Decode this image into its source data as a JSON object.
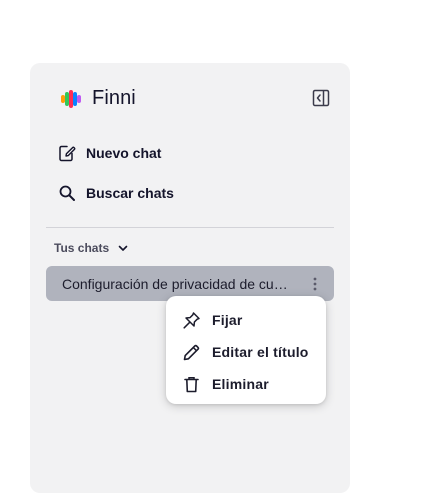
{
  "sidebar": {
    "brand_name": "Finni",
    "brand_colors": [
      "#ff2d55",
      "#ff9f0a",
      "#34c759",
      "#0a84ff",
      "#bf5af2"
    ],
    "collapse_icon": "sidebar-collapse-icon",
    "nav": [
      {
        "label": "Nuevo chat",
        "icon": "new-chat-icon"
      },
      {
        "label": "Buscar chats",
        "icon": "search-icon"
      }
    ],
    "section_label": "Tus chats",
    "chats": [
      {
        "title": "Configuración de privacidad de cuenta",
        "selected": true
      }
    ]
  },
  "context_menu": {
    "items": [
      {
        "label": "Fijar",
        "icon": "pin-icon"
      },
      {
        "label": "Editar el título",
        "icon": "pencil-icon"
      },
      {
        "label": "Eliminar",
        "icon": "trash-icon"
      }
    ]
  }
}
